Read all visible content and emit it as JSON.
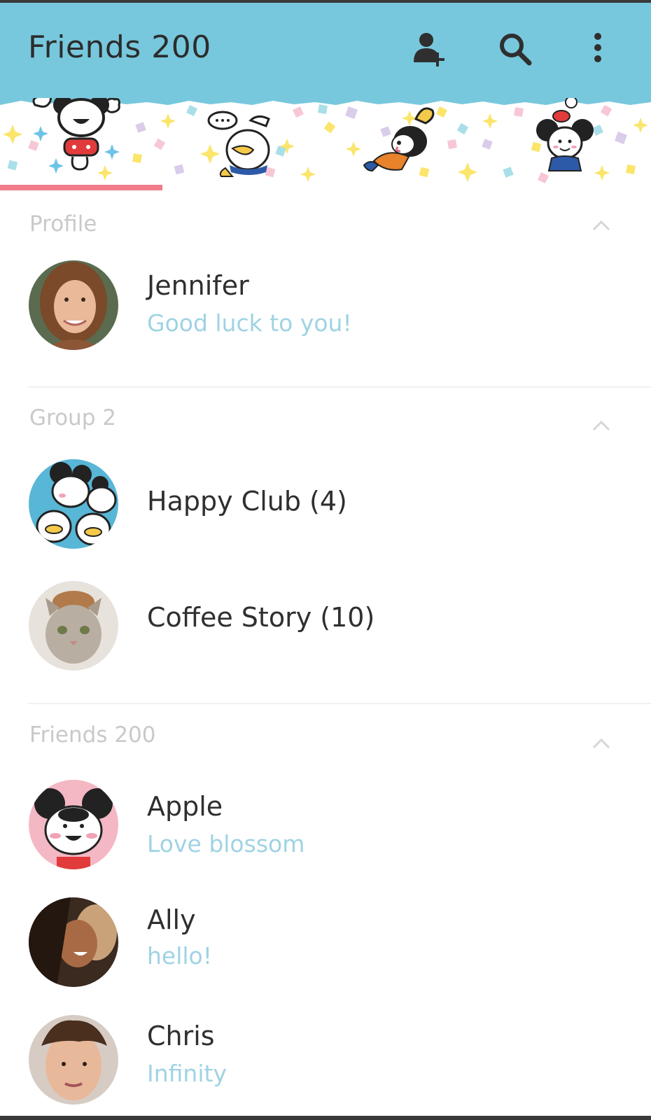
{
  "header": {
    "title": "Friends 200",
    "icons": [
      "add-friend-icon",
      "search-icon",
      "more-vertical-icon"
    ],
    "bg_color": "#77c8dd"
  },
  "tabs": {
    "items": [
      "mickey-sticker-tab",
      "donald-sticker-tab",
      "goofy-sticker-tab",
      "minnie-sticker-tab"
    ],
    "active_index": 0,
    "accent": "#f07b8a"
  },
  "sections": {
    "profile": {
      "title": "Profile",
      "items": [
        {
          "name": "Jennifer",
          "status": "Good luck to you!"
        }
      ]
    },
    "groups": {
      "title": "Group 2",
      "items": [
        {
          "name": "Happy Club (4)"
        },
        {
          "name": "Coffee Story (10)"
        }
      ]
    },
    "friends": {
      "title": "Friends 200",
      "items": [
        {
          "name": "Apple",
          "status": "Love blossom"
        },
        {
          "name": "Ally",
          "status": "hello!"
        },
        {
          "name": "Chris",
          "status": "Infinity"
        }
      ]
    }
  }
}
